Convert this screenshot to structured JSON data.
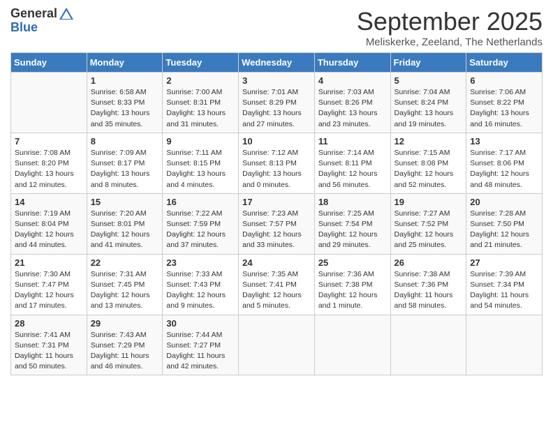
{
  "header": {
    "logo_line1": "General",
    "logo_line2": "Blue",
    "title": "September 2025",
    "location": "Meliskerke, Zeeland, The Netherlands"
  },
  "calendar": {
    "columns": [
      "Sunday",
      "Monday",
      "Tuesday",
      "Wednesday",
      "Thursday",
      "Friday",
      "Saturday"
    ],
    "weeks": [
      [
        {
          "day": "",
          "info": ""
        },
        {
          "day": "1",
          "info": "Sunrise: 6:58 AM\nSunset: 8:33 PM\nDaylight: 13 hours\nand 35 minutes."
        },
        {
          "day": "2",
          "info": "Sunrise: 7:00 AM\nSunset: 8:31 PM\nDaylight: 13 hours\nand 31 minutes."
        },
        {
          "day": "3",
          "info": "Sunrise: 7:01 AM\nSunset: 8:29 PM\nDaylight: 13 hours\nand 27 minutes."
        },
        {
          "day": "4",
          "info": "Sunrise: 7:03 AM\nSunset: 8:26 PM\nDaylight: 13 hours\nand 23 minutes."
        },
        {
          "day": "5",
          "info": "Sunrise: 7:04 AM\nSunset: 8:24 PM\nDaylight: 13 hours\nand 19 minutes."
        },
        {
          "day": "6",
          "info": "Sunrise: 7:06 AM\nSunset: 8:22 PM\nDaylight: 13 hours\nand 16 minutes."
        }
      ],
      [
        {
          "day": "7",
          "info": "Sunrise: 7:08 AM\nSunset: 8:20 PM\nDaylight: 13 hours\nand 12 minutes."
        },
        {
          "day": "8",
          "info": "Sunrise: 7:09 AM\nSunset: 8:17 PM\nDaylight: 13 hours\nand 8 minutes."
        },
        {
          "day": "9",
          "info": "Sunrise: 7:11 AM\nSunset: 8:15 PM\nDaylight: 13 hours\nand 4 minutes."
        },
        {
          "day": "10",
          "info": "Sunrise: 7:12 AM\nSunset: 8:13 PM\nDaylight: 13 hours\nand 0 minutes."
        },
        {
          "day": "11",
          "info": "Sunrise: 7:14 AM\nSunset: 8:11 PM\nDaylight: 12 hours\nand 56 minutes."
        },
        {
          "day": "12",
          "info": "Sunrise: 7:15 AM\nSunset: 8:08 PM\nDaylight: 12 hours\nand 52 minutes."
        },
        {
          "day": "13",
          "info": "Sunrise: 7:17 AM\nSunset: 8:06 PM\nDaylight: 12 hours\nand 48 minutes."
        }
      ],
      [
        {
          "day": "14",
          "info": "Sunrise: 7:19 AM\nSunset: 8:04 PM\nDaylight: 12 hours\nand 44 minutes."
        },
        {
          "day": "15",
          "info": "Sunrise: 7:20 AM\nSunset: 8:01 PM\nDaylight: 12 hours\nand 41 minutes."
        },
        {
          "day": "16",
          "info": "Sunrise: 7:22 AM\nSunset: 7:59 PM\nDaylight: 12 hours\nand 37 minutes."
        },
        {
          "day": "17",
          "info": "Sunrise: 7:23 AM\nSunset: 7:57 PM\nDaylight: 12 hours\nand 33 minutes."
        },
        {
          "day": "18",
          "info": "Sunrise: 7:25 AM\nSunset: 7:54 PM\nDaylight: 12 hours\nand 29 minutes."
        },
        {
          "day": "19",
          "info": "Sunrise: 7:27 AM\nSunset: 7:52 PM\nDaylight: 12 hours\nand 25 minutes."
        },
        {
          "day": "20",
          "info": "Sunrise: 7:28 AM\nSunset: 7:50 PM\nDaylight: 12 hours\nand 21 minutes."
        }
      ],
      [
        {
          "day": "21",
          "info": "Sunrise: 7:30 AM\nSunset: 7:47 PM\nDaylight: 12 hours\nand 17 minutes."
        },
        {
          "day": "22",
          "info": "Sunrise: 7:31 AM\nSunset: 7:45 PM\nDaylight: 12 hours\nand 13 minutes."
        },
        {
          "day": "23",
          "info": "Sunrise: 7:33 AM\nSunset: 7:43 PM\nDaylight: 12 hours\nand 9 minutes."
        },
        {
          "day": "24",
          "info": "Sunrise: 7:35 AM\nSunset: 7:41 PM\nDaylight: 12 hours\nand 5 minutes."
        },
        {
          "day": "25",
          "info": "Sunrise: 7:36 AM\nSunset: 7:38 PM\nDaylight: 12 hours\nand 1 minute."
        },
        {
          "day": "26",
          "info": "Sunrise: 7:38 AM\nSunset: 7:36 PM\nDaylight: 11 hours\nand 58 minutes."
        },
        {
          "day": "27",
          "info": "Sunrise: 7:39 AM\nSunset: 7:34 PM\nDaylight: 11 hours\nand 54 minutes."
        }
      ],
      [
        {
          "day": "28",
          "info": "Sunrise: 7:41 AM\nSunset: 7:31 PM\nDaylight: 11 hours\nand 50 minutes."
        },
        {
          "day": "29",
          "info": "Sunrise: 7:43 AM\nSunset: 7:29 PM\nDaylight: 11 hours\nand 46 minutes."
        },
        {
          "day": "30",
          "info": "Sunrise: 7:44 AM\nSunset: 7:27 PM\nDaylight: 11 hours\nand 42 minutes."
        },
        {
          "day": "",
          "info": ""
        },
        {
          "day": "",
          "info": ""
        },
        {
          "day": "",
          "info": ""
        },
        {
          "day": "",
          "info": ""
        }
      ]
    ]
  }
}
